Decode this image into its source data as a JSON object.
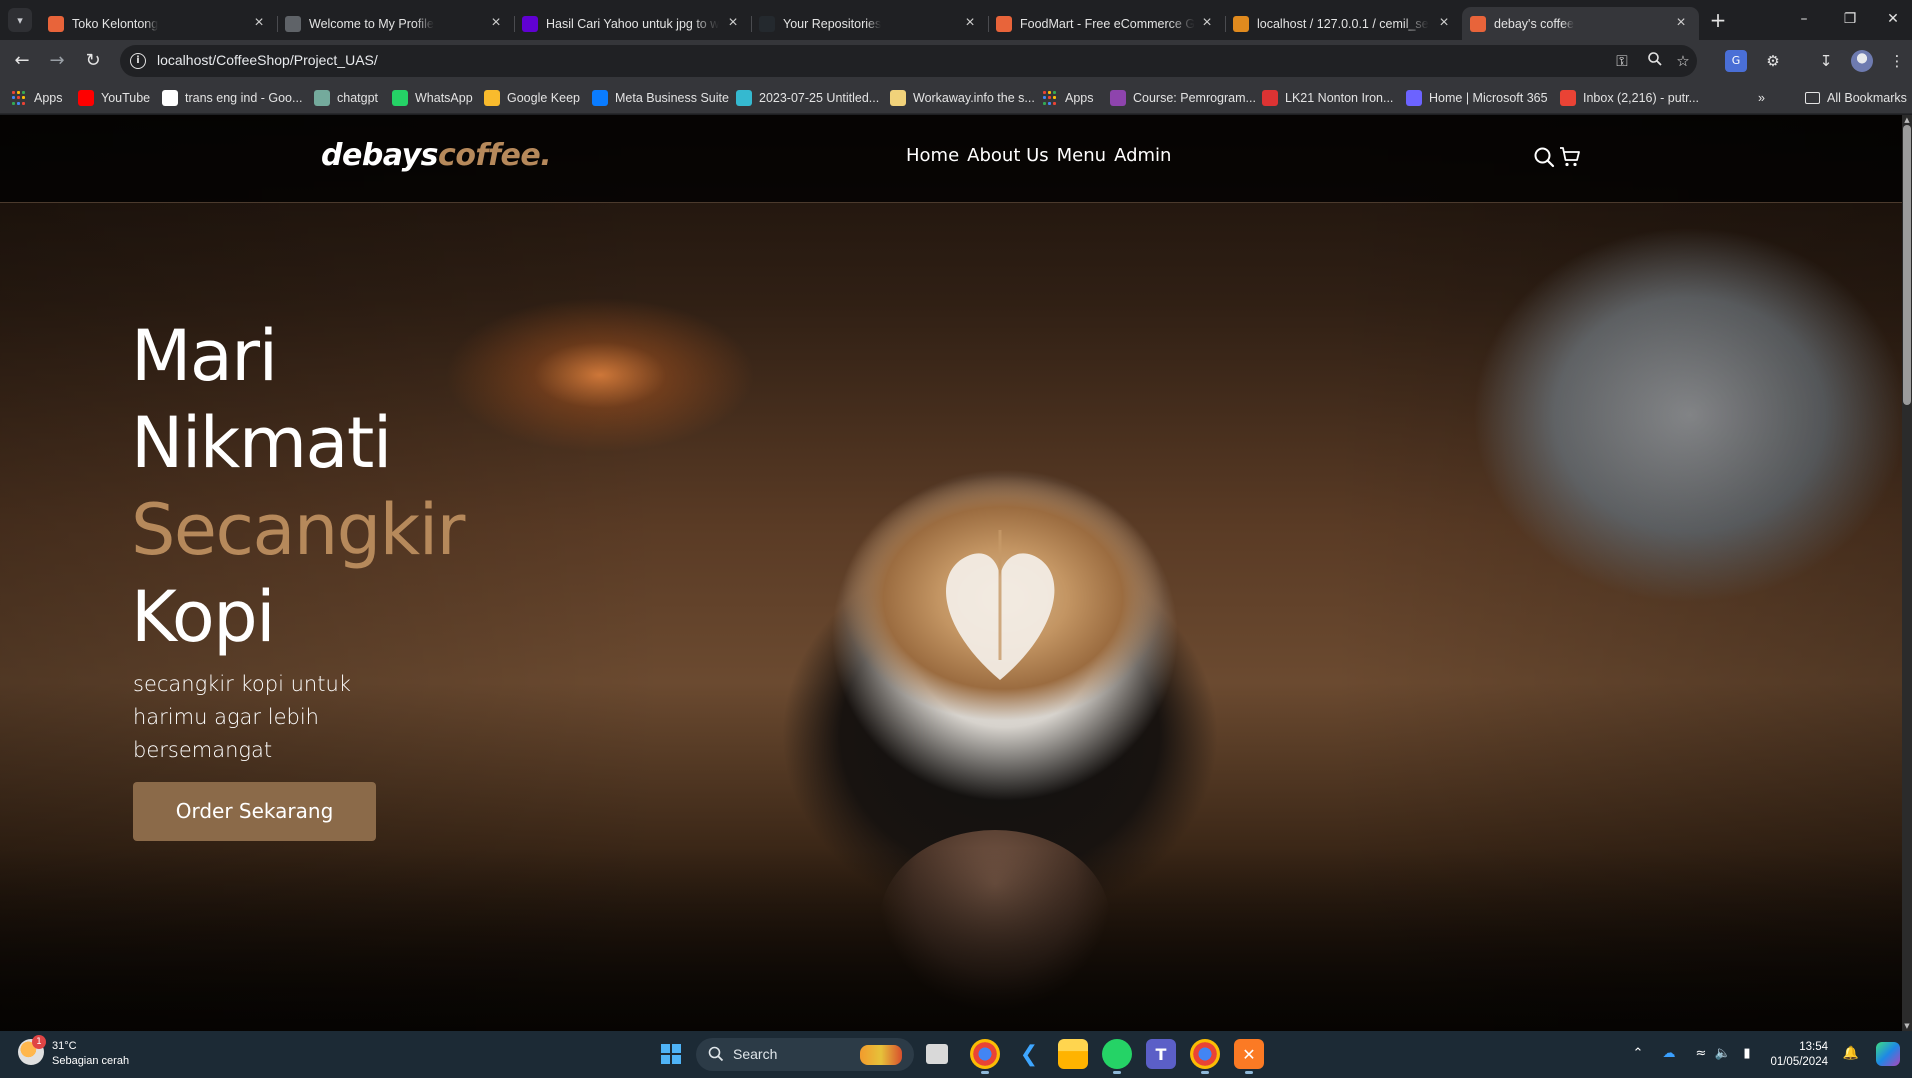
{
  "browser": {
    "tabs": [
      {
        "title": "Toko Kelontong",
        "favicon": "xampp-icon",
        "color": "#e8643a"
      },
      {
        "title": "Welcome to My Profile",
        "favicon": "globe-icon",
        "color": "#5f6368"
      },
      {
        "title": "Hasil Cari Yahoo untuk jpg to w",
        "favicon": "yahoo-icon",
        "color": "#6001d2"
      },
      {
        "title": "Your Repositories",
        "favicon": "github-icon",
        "color": "#24292e"
      },
      {
        "title": "FoodMart - Free eCommerce G",
        "favicon": "xampp-icon",
        "color": "#e8643a"
      },
      {
        "title": "localhost / 127.0.0.1 / cemil_se",
        "favicon": "phpmyadmin-icon",
        "color": "#e08a1e"
      },
      {
        "title": "debay's coffee",
        "favicon": "xampp-icon",
        "color": "#e8643a",
        "active": true
      }
    ],
    "url": "localhost/CoffeeShop/Project_UAS/",
    "bookmarks": [
      {
        "label": "Apps",
        "icon": "apps-grid-icon"
      },
      {
        "label": "YouTube",
        "icon": "youtube-icon",
        "color": "#ff0000"
      },
      {
        "label": "trans eng ind - Goo...",
        "icon": "google-icon",
        "color": "#ffffff"
      },
      {
        "label": "chatgpt",
        "icon": "chatgpt-icon",
        "color": "#74aa9c"
      },
      {
        "label": "WhatsApp",
        "icon": "whatsapp-icon",
        "color": "#25d366"
      },
      {
        "label": "Google Keep",
        "icon": "keep-icon",
        "color": "#f9bb2d"
      },
      {
        "label": "Meta Business Suite",
        "icon": "meta-icon",
        "color": "#0a7cff"
      },
      {
        "label": "2023-07-25 Untitled...",
        "icon": "canva-icon",
        "color": "#35b9d0"
      },
      {
        "label": "Workaway.info the s...",
        "icon": "workaway-icon",
        "color": "#f1d27a"
      },
      {
        "label": "Apps",
        "icon": "apps-grid-icon"
      },
      {
        "label": "Course: Pemrogram...",
        "icon": "course-icon",
        "color": "#8e44ad"
      },
      {
        "label": "LK21 Nonton Iron...",
        "icon": "lk21-icon",
        "color": "#d33"
      },
      {
        "label": "Home | Microsoft 365",
        "icon": "m365-icon",
        "color": "#6c63ff"
      },
      {
        "label": "Inbox (2,216) - putr...",
        "icon": "gmail-icon",
        "color": "#ea4335"
      }
    ],
    "all_bookmarks_label": "All Bookmarks"
  },
  "site": {
    "logo_main": "debays",
    "logo_accent": "coffee.",
    "nav": [
      "Home",
      "About Us",
      "Menu",
      "Admin"
    ],
    "hero": {
      "line1": "Mari",
      "line2": "Nikmati",
      "line3": "Secangkir",
      "line4": "Kopi",
      "subtitle": "secangkir kopi untuk harimu agar lebih bersemangat",
      "cta": "Order Sekarang"
    },
    "colors": {
      "accent": "#b6895b",
      "button": "#8b6a49"
    }
  },
  "taskbar": {
    "weather_temp": "31°C",
    "weather_desc": "Sebagian cerah",
    "weather_badge": "1",
    "search_label": "Search",
    "time": "13:54",
    "date": "01/05/2024"
  }
}
